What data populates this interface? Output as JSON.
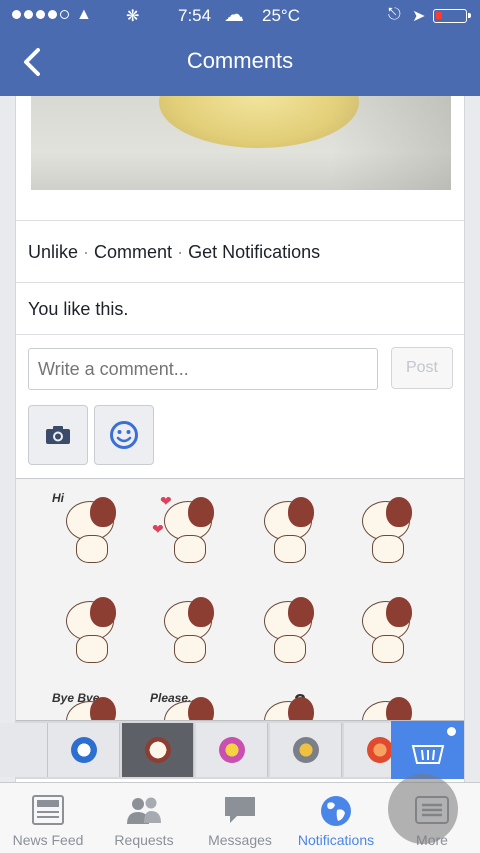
{
  "status_bar": {
    "time": "7:54",
    "temperature": "25°C",
    "signal_dots_filled": 4,
    "battery_level": 0.12
  },
  "nav": {
    "title": "Comments",
    "back_icon": "chevron-left-icon"
  },
  "post": {
    "actions": [
      "Unlike",
      "Comment",
      "Get Notifications"
    ],
    "separator": "·",
    "likes_text": "You like this."
  },
  "composer": {
    "placeholder": "Write a comment...",
    "post_label": "Post",
    "camera_icon": "camera-icon",
    "sticker_icon": "smiley-icon"
  },
  "stickers": {
    "captions": [
      "Hi",
      "Bye Bye",
      "Please..."
    ]
  },
  "tabs": [
    {
      "label": "News Feed",
      "icon": "news-feed-icon",
      "active": false
    },
    {
      "label": "Requests",
      "icon": "friend-requests-icon",
      "active": false
    },
    {
      "label": "Messages",
      "icon": "messages-icon",
      "active": false
    },
    {
      "label": "Notifications",
      "icon": "globe-icon",
      "active": true
    },
    {
      "label": "More",
      "icon": "more-icon",
      "active": false
    }
  ],
  "colors": {
    "header": "#4a6bb0",
    "accent": "#4a86e8",
    "store": "#4a86e8"
  }
}
